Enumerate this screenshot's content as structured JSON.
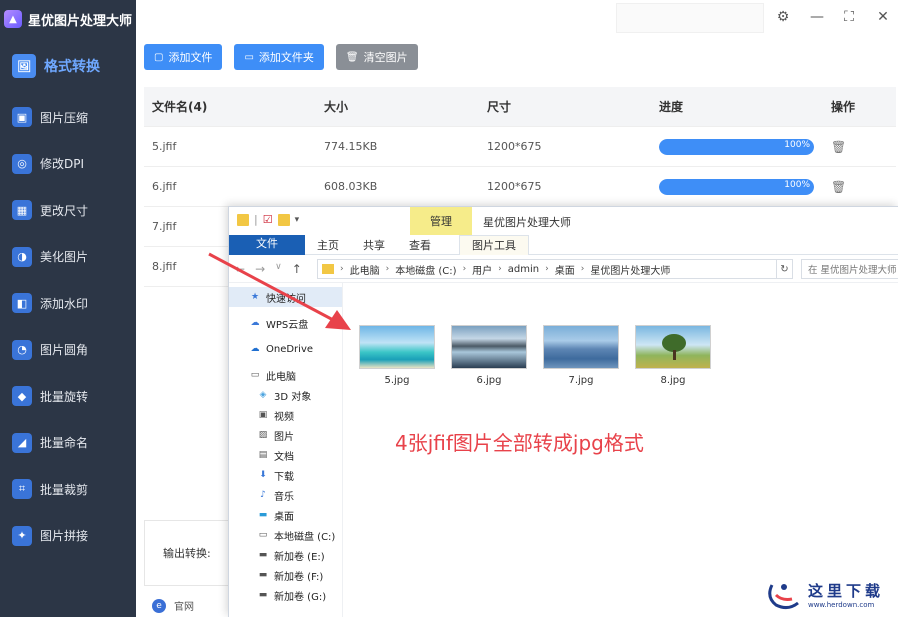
{
  "app": {
    "title": "星优图片处理大师"
  },
  "sidebar": {
    "items": [
      {
        "label": "格式转换",
        "icon": "image-convert-icon",
        "active": true
      },
      {
        "label": "图片压缩",
        "icon": "compress-icon"
      },
      {
        "label": "修改DPI",
        "icon": "dpi-icon"
      },
      {
        "label": "更改尺寸",
        "icon": "resize-icon"
      },
      {
        "label": "美化图片",
        "icon": "beautify-icon"
      },
      {
        "label": "添加水印",
        "icon": "watermark-icon"
      },
      {
        "label": "图片圆角",
        "icon": "round-corner-icon"
      },
      {
        "label": "批量旋转",
        "icon": "rotate-icon"
      },
      {
        "label": "批量命名",
        "icon": "rename-icon"
      },
      {
        "label": "批量裁剪",
        "icon": "crop-icon"
      },
      {
        "label": "图片拼接",
        "icon": "stitch-icon"
      }
    ]
  },
  "toolbar": {
    "add_file": "添加文件",
    "add_folder": "添加文件夹",
    "clear": "清空图片"
  },
  "table": {
    "headers": {
      "name": "文件名(4)",
      "size": "大小",
      "dimensions": "尺寸",
      "progress": "进度",
      "actions": "操作"
    },
    "rows": [
      {
        "name": "5.jfif",
        "size": "774.15KB",
        "dimensions": "1200*675",
        "progress": 1.0,
        "progress_text": "100%"
      },
      {
        "name": "6.jfif",
        "size": "608.03KB",
        "dimensions": "1200*675",
        "progress": 1.0,
        "progress_text": "100%"
      },
      {
        "name": "7.jfif"
      },
      {
        "name": "8.jfif"
      }
    ]
  },
  "output": {
    "label": "输出转换:"
  },
  "footer": {
    "website": "官网"
  },
  "explorer": {
    "manage_tab": "管理",
    "title": "星优图片处理大师",
    "ribbon_tabs": [
      "文件",
      "主页",
      "共享",
      "查看",
      "图片工具"
    ],
    "breadcrumbs": [
      "此电脑",
      "本地磁盘 (C:)",
      "用户",
      "admin",
      "桌面",
      "星优图片处理大师"
    ],
    "search_placeholder": "在 星优图片处理大师",
    "nav_pane": [
      {
        "label": "快速访问",
        "icon": "star-icon",
        "selected": true
      },
      {
        "label": "WPS云盘",
        "icon": "cloud-icon"
      },
      {
        "label": "OneDrive",
        "icon": "onedrive-icon"
      },
      {
        "label": "此电脑",
        "icon": "computer-icon"
      },
      {
        "label": "3D 对象",
        "icon": "cube-icon",
        "indent": true
      },
      {
        "label": "视频",
        "icon": "video-icon",
        "indent": true
      },
      {
        "label": "图片",
        "icon": "picture-icon",
        "indent": true
      },
      {
        "label": "文档",
        "icon": "document-icon",
        "indent": true
      },
      {
        "label": "下载",
        "icon": "download-icon",
        "indent": true
      },
      {
        "label": "音乐",
        "icon": "music-icon",
        "indent": true
      },
      {
        "label": "桌面",
        "icon": "desktop-icon",
        "indent": true
      },
      {
        "label": "本地磁盘 (C:)",
        "icon": "disk-icon",
        "indent": true
      },
      {
        "label": "新加卷 (E:)",
        "icon": "drive-icon",
        "indent": true
      },
      {
        "label": "新加卷 (F:)",
        "icon": "drive-icon",
        "indent": true
      },
      {
        "label": "新加卷 (G:)",
        "icon": "drive-icon",
        "indent": true
      }
    ],
    "files": [
      {
        "name": "5.jpg"
      },
      {
        "name": "6.jpg"
      },
      {
        "name": "7.jpg"
      },
      {
        "name": "8.jpg"
      }
    ]
  },
  "annotation": "4张jfif图片全部转成jpg格式",
  "watermark": {
    "text": "这里下载",
    "url": "www.herdown.com"
  },
  "colors": {
    "sidebar_bg": "#2c3646",
    "accent": "#3e8ef7",
    "annotation": "#e8424a"
  }
}
